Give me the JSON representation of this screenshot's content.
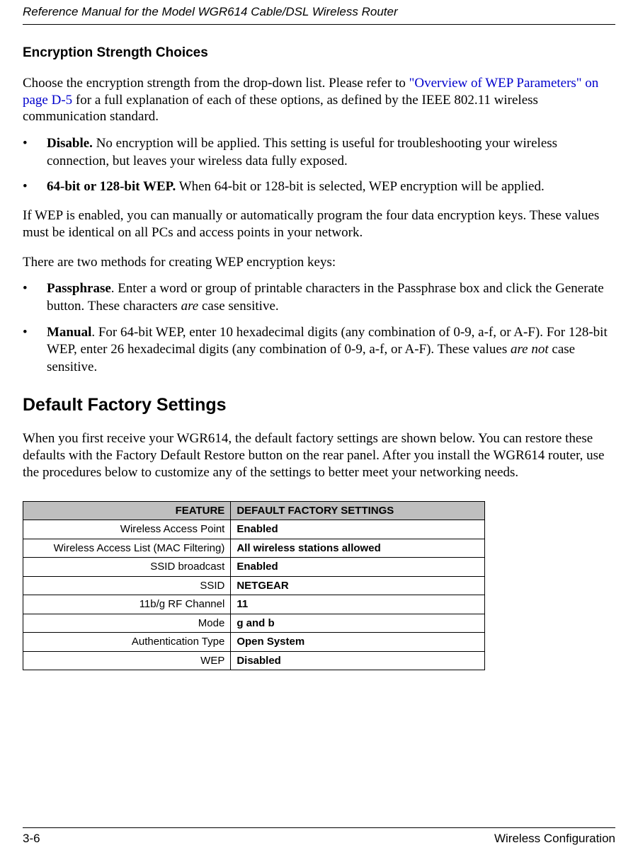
{
  "header": {
    "doc_title": "Reference Manual for the Model WGR614 Cable/DSL Wireless Router"
  },
  "sub1": {
    "title": "Encryption Strength Choices",
    "intro_pre": "Choose the encryption strength from the drop-down list. Please refer to ",
    "intro_link": "\"Overview of WEP Parameters\" on page D-5",
    "intro_post": " for a full explanation of each of these options, as defined by the IEEE 802.11 wireless communication standard.",
    "bullets1": [
      {
        "lead": "Disable.",
        "rest": " No encryption will be applied. This setting is useful for troubleshooting your wireless connection, but leaves your wireless data fully exposed."
      },
      {
        "lead": "64-bit or 128-bit WEP.",
        "rest": " When 64-bit or 128-bit is selected, WEP encryption will be applied."
      }
    ],
    "para_after1": "If WEP is enabled, you can manually or automatically program the four data encryption keys. These values must be identical on all PCs and access points in your network.",
    "para_after2": "There are two methods for creating WEP encryption keys:",
    "bullets2": [
      {
        "lead": "Passphrase",
        "mid": ". Enter a word or group of printable characters in the Passphrase box and click the Generate button. These characters ",
        "ital": "are",
        "tail": " case sensitive."
      },
      {
        "lead": "Manual",
        "mid": ". For 64-bit WEP, enter 10 hexadecimal digits (any combination of 0-9, a-f, or A-F). For 128-bit WEP, enter 26 hexadecimal digits (any combination of 0-9, a-f, or A-F). These values ",
        "ital": "are not",
        "tail": " case sensitive."
      }
    ]
  },
  "section2": {
    "title": "Default Factory Settings",
    "intro": "When you first receive your WGR614, the default factory settings are shown below. You can restore these defaults with the Factory Default Restore button on the rear panel. After you install the WGR614 router, use the procedures below to customize any of the settings to better meet your networking needs."
  },
  "table": {
    "head_feature": "FEATURE",
    "head_default": "DEFAULT FACTORY SETTINGS",
    "rows": [
      {
        "feature": "Wireless Access Point",
        "value": "Enabled"
      },
      {
        "feature": "Wireless Access List (MAC Filtering)",
        "value": "All wireless stations allowed"
      },
      {
        "feature": "SSID broadcast",
        "value": "Enabled"
      },
      {
        "feature": "SSID",
        "value": "NETGEAR"
      },
      {
        "feature": "11b/g RF Channel",
        "value": "11"
      },
      {
        "feature": "Mode",
        "value": "g and b"
      },
      {
        "feature": "Authentication Type",
        "value": "Open System"
      },
      {
        "feature": "WEP",
        "value": "Disabled"
      }
    ]
  },
  "footer": {
    "page_num": "3-6",
    "section": "Wireless Configuration"
  }
}
